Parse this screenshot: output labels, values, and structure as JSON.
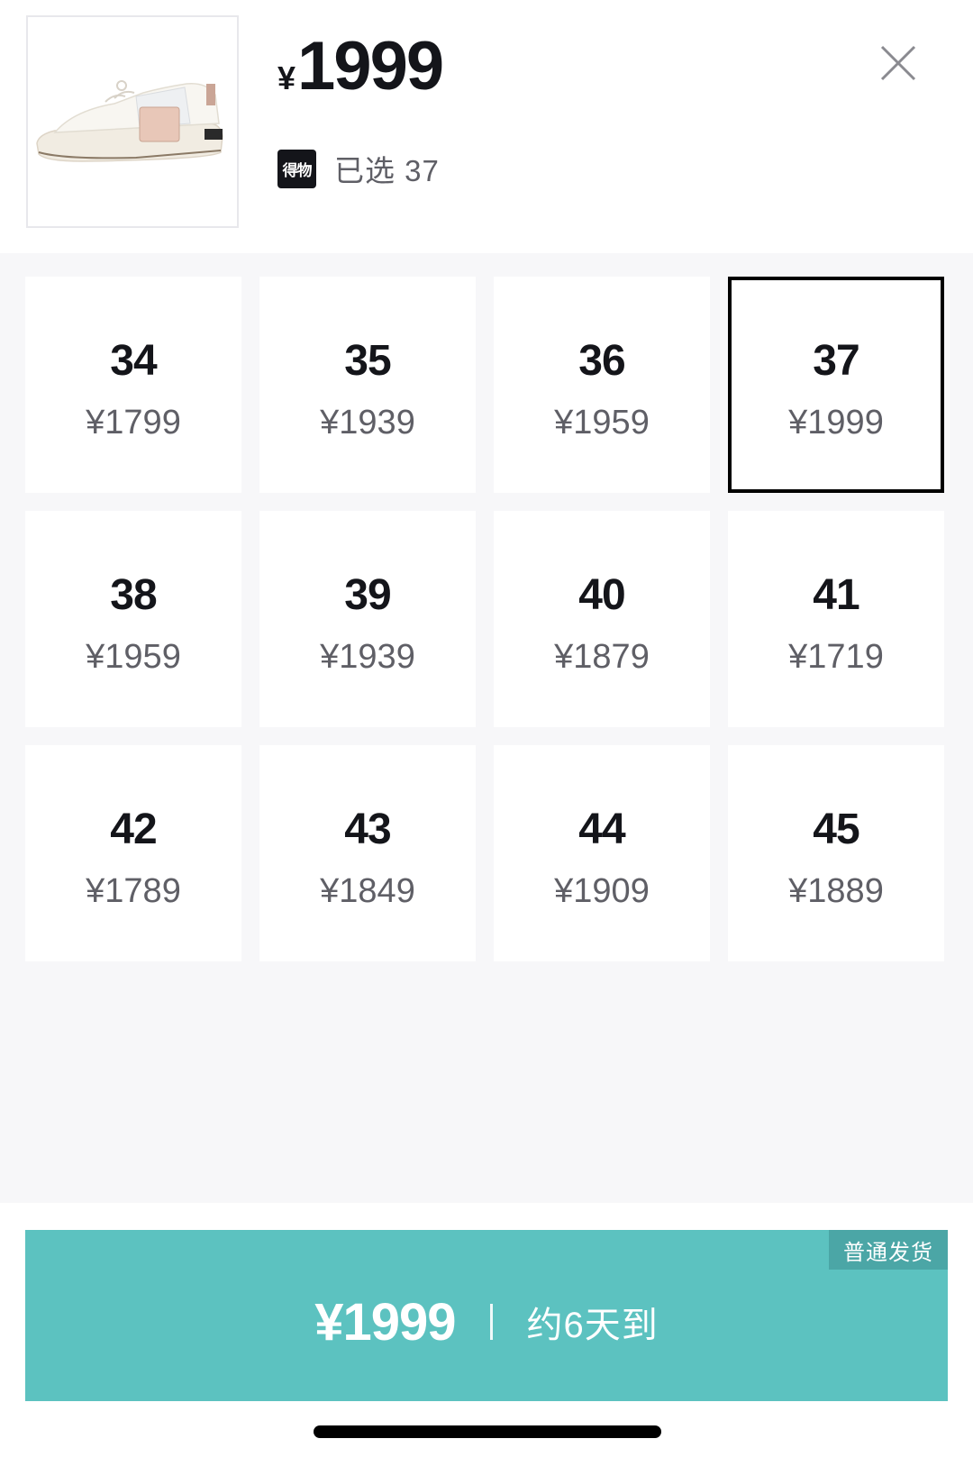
{
  "product": {
    "currency_symbol": "¥",
    "price": "1999",
    "brand_badge": "得物",
    "selected_label": "已选 37"
  },
  "icons": {
    "close": "close-icon",
    "shoe": "sneaker-image"
  },
  "sizes": [
    {
      "size": "34",
      "price": "¥1799",
      "selected": false
    },
    {
      "size": "35",
      "price": "¥1939",
      "selected": false
    },
    {
      "size": "36",
      "price": "¥1959",
      "selected": false
    },
    {
      "size": "37",
      "price": "¥1999",
      "selected": true
    },
    {
      "size": "38",
      "price": "¥1959",
      "selected": false
    },
    {
      "size": "39",
      "price": "¥1939",
      "selected": false
    },
    {
      "size": "40",
      "price": "¥1879",
      "selected": false
    },
    {
      "size": "41",
      "price": "¥1719",
      "selected": false
    },
    {
      "size": "42",
      "price": "¥1789",
      "selected": false
    },
    {
      "size": "43",
      "price": "¥1849",
      "selected": false
    },
    {
      "size": "44",
      "price": "¥1909",
      "selected": false
    },
    {
      "size": "45",
      "price": "¥1889",
      "selected": false
    }
  ],
  "buy_button": {
    "shipping_tag": "普通发货",
    "price": "¥1999",
    "eta": "约6天到"
  },
  "colors": {
    "accent": "#5cc2c0",
    "tag": "#4ba6a6",
    "text_dark": "#14151a",
    "text_gray": "#5f5f66",
    "grid_bg": "#f7f7f9"
  }
}
